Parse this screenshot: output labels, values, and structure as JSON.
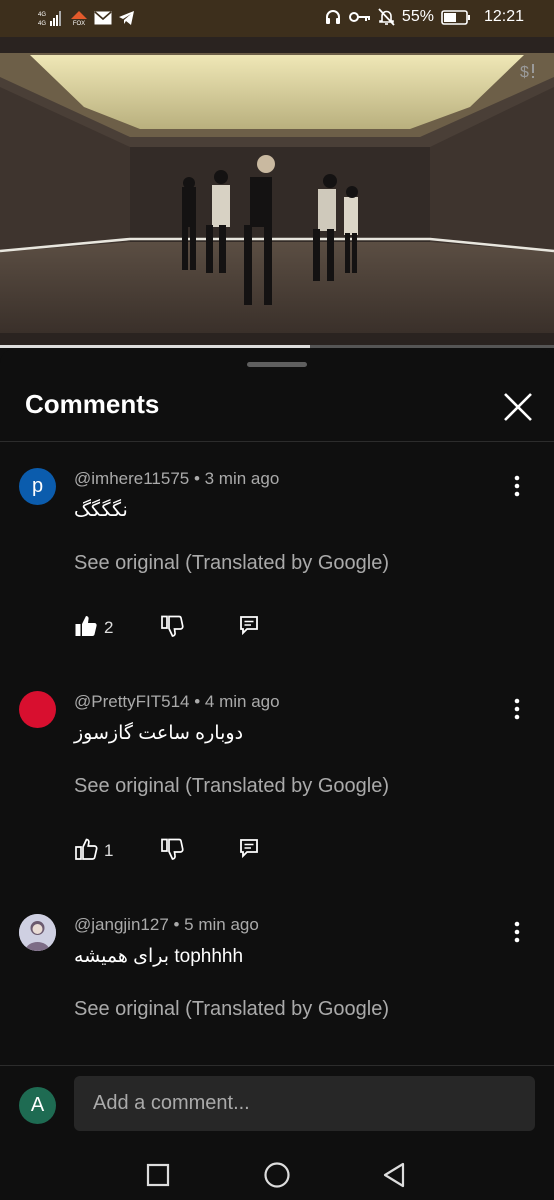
{
  "status_bar": {
    "carrier_text": "FOX",
    "battery_percent": "55%",
    "time": "12:21"
  },
  "video": {
    "progress_fraction": 0.56
  },
  "comments_panel": {
    "title": "Comments",
    "comments": [
      {
        "avatar_letter": "p",
        "avatar_color": "#0b5cad",
        "meta": "@imhere11575 • 3 min ago",
        "text": "نگگگگ",
        "see_original": "See original (Translated by Google)",
        "like_count": "2",
        "liked": true
      },
      {
        "avatar_letter": "",
        "avatar_color": "#d80f2f",
        "meta": "@PrettyFIT514 • 4 min ago",
        "text": "دوباره ساعت گازسوز",
        "see_original": "See original (Translated by Google)",
        "like_count": "1",
        "liked": false
      },
      {
        "avatar_letter": "",
        "avatar_color": "#c9c9dd",
        "meta": "@jangjin127 • 5 min ago",
        "text": "برای همیشه tophhhh",
        "see_original": "See original (Translated by Google)"
      }
    ]
  },
  "composer": {
    "avatar_letter": "A",
    "placeholder": "Add a comment..."
  },
  "icons": {
    "status_left": [
      "signal-icon",
      "wifi-icon",
      "fox-icon",
      "mail-icon",
      "telegram-icon"
    ],
    "status_right": [
      "headphones-icon",
      "key-icon",
      "bell-muted-icon",
      "battery-icon"
    ],
    "video_overlay": "paid-promotion-icon",
    "close": "close-icon",
    "more": "more-vertical-icon",
    "actions": [
      "thumbs-up-icon",
      "thumbs-down-icon",
      "reply-icon"
    ],
    "nav": [
      "recent-apps-icon",
      "home-icon",
      "back-icon"
    ]
  }
}
